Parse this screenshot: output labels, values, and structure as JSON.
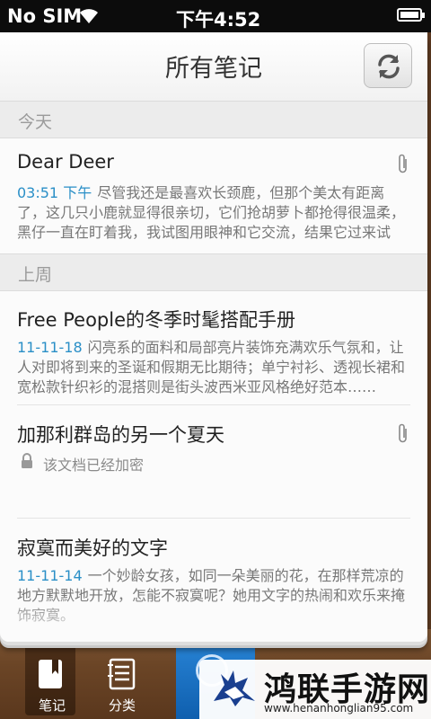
{
  "status_bar": {
    "carrier": "No SIM",
    "time": "下午4:52"
  },
  "header": {
    "title": "所有笔记"
  },
  "sections": {
    "today": "今天",
    "last_week": "上周"
  },
  "notes": [
    {
      "title": "Dear Deer",
      "date": "03:51 下午",
      "body": "尽管我还是最喜欢长颈鹿，但那个美太有距离了，这几只小鹿就显得很亲切，它们抢胡萝卜都抢得很温柔，黑仔一直在盯着我，我试图用眼神和它交流，结果它过来试",
      "attachment_icon": "paperclip-icon"
    },
    {
      "title": "Free People的冬季时髦搭配手册",
      "date": "11-11-18",
      "body": "闪亮系的面料和局部亮片装饰充满欢乐气氛和，让人对即将到来的圣诞和假期无比期待；单宁衬衫、透视长裙和宽松款针织衫的混搭则是街头波西米亚风格绝好范本……"
    },
    {
      "title": "加那利群岛的另一个夏天",
      "locked_text": "该文档已经加密",
      "attachment_icon": "paperclip-icon",
      "lock_icon": "lock-icon"
    },
    {
      "title": "寂寞而美好的文字",
      "date": "11-11-14",
      "body": "一个妙龄女孩，如同一朵美丽的花，在那样荒凉的地方默默地开放，怎能不寂寞呢？她用文字的热闹和欢乐来掩饰寂寞。"
    }
  ],
  "tabs": {
    "notes": "笔记",
    "category": "分类"
  },
  "watermark": {
    "brand": "鸿联手游网",
    "url": "www.henanhonglian95.com"
  },
  "colors": {
    "accent_blue": "#2a8fc7",
    "wood": "#6b4526",
    "button_blue": "#1a73c4"
  }
}
